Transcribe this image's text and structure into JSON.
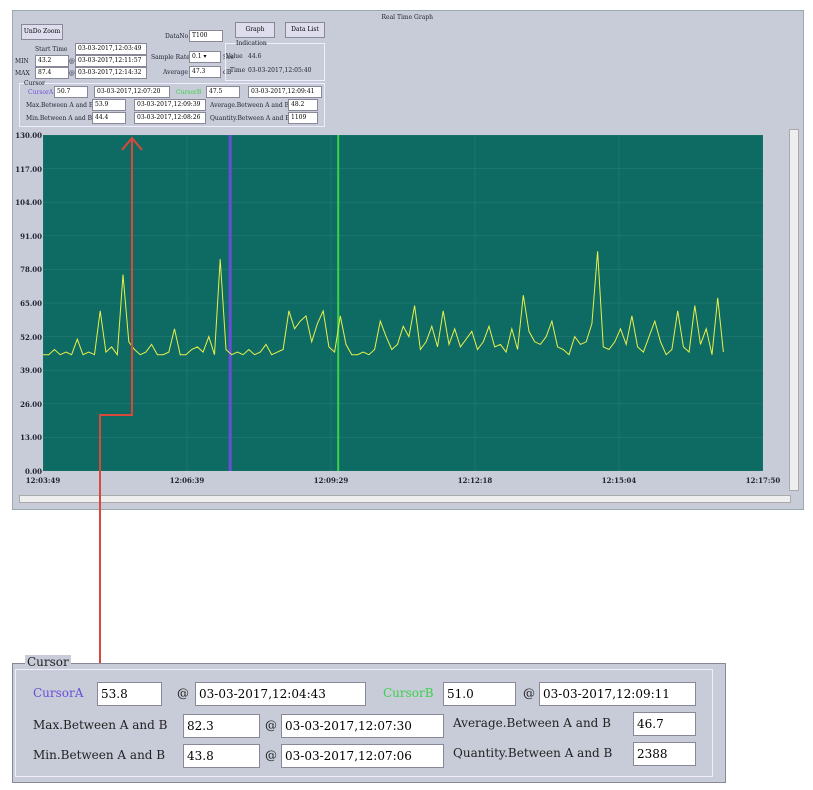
{
  "window": {
    "title": "Real Time Graph"
  },
  "toolbar": {
    "undo_zoom": "UnDo Zoom",
    "graph": "Graph",
    "data_list": "Data List"
  },
  "stats": {
    "data_no_label": "DataNo",
    "data_no": "T100",
    "start_time_label": "Start Time",
    "start_time": "03-03-2017,12:03:49",
    "min_label": "MIN",
    "min_value": "43.2",
    "min_time": "03-03-2017,12:11:57",
    "max_label": "MAX",
    "max_value": "87.4",
    "max_time": "03-03-2017,12:14:32",
    "at": "@",
    "sample_rate_label": "Sample Rate",
    "sample_rate": "0.1",
    "sample_rate_unit": "Sec",
    "average_label": "Average",
    "average": "47.3",
    "average_unit": "dB"
  },
  "indication": {
    "title": "Indication",
    "value_label": "Value",
    "value": "44.6",
    "time_label": "Time",
    "time": "03-03-2017,12:05:40"
  },
  "cursor_small": {
    "title": "Cursor",
    "a_label": "CursorA",
    "a_value": "50.7",
    "a_time": "03-03-2017,12:07:20",
    "b_label": "CursorB",
    "b_value": "47.5",
    "b_time": "03-03-2017,12:09:41",
    "max_label": "Max.Between A and B",
    "max_value": "53.9",
    "max_time": "03-03-2017,12:09:39",
    "min_label": "Min.Between A and B",
    "min_value": "44.4",
    "min_time": "03-03-2017,12:08:26",
    "avg_label": "Average.Between A and B",
    "avg_value": "48.2",
    "qty_label": "Quantity.Between A and B",
    "qty_value": "1109"
  },
  "cursor_zoomed": {
    "title": "Cursor",
    "a_label": "CursorA",
    "a_value": "53.8",
    "a_time": "03-03-2017,12:04:43",
    "b_label": "CursorB",
    "b_value": "51.0",
    "b_time": "03-03-2017,12:09:11",
    "max_label": "Max.Between A and B",
    "max_value": "82.3",
    "max_time": "03-03-2017,12:07:30",
    "min_label": "Min.Between A and B",
    "min_value": "43.8",
    "min_time": "03-03-2017,12:07:06",
    "avg_label": "Average.Between A and B",
    "avg_value": "46.7",
    "qty_label": "Quantity.Between A and B",
    "qty_value": "2388",
    "at": "@"
  },
  "colors": {
    "plot_bg": "#0e6b63",
    "line": "#e8f04a",
    "cursor_a": "#6a4cd8",
    "cursor_b": "#3ad24a",
    "arrow": "#d9483a"
  },
  "chart_data": {
    "type": "line",
    "ylim": [
      0,
      130
    ],
    "yticks": [
      "130.00",
      "117.00",
      "104.00",
      "91.00",
      "78.00",
      "65.00",
      "52.00",
      "39.00",
      "26.00",
      "13.00",
      "0.00"
    ],
    "xticks": [
      "12:03:49",
      "12:06:39",
      "12:09:29",
      "12:12:18",
      "12:15:04",
      "12:17:50"
    ],
    "cursor_a_frac": 0.26,
    "cursor_b_frac": 0.41,
    "values": [
      45,
      45,
      47,
      45,
      46,
      45,
      51,
      45,
      46,
      45,
      62,
      46,
      48,
      45,
      76,
      50,
      47,
      45,
      46,
      49,
      45,
      45,
      46,
      55,
      45,
      45,
      47,
      48,
      46,
      52,
      45,
      82,
      47,
      45,
      46,
      45,
      47,
      45,
      46,
      49,
      45,
      46,
      47,
      62,
      55,
      58,
      60,
      50,
      57,
      62,
      48,
      46,
      60,
      49,
      45,
      45,
      46,
      45,
      47,
      58,
      52,
      47,
      49,
      56,
      52,
      64,
      47,
      50,
      56,
      48,
      62,
      49,
      55,
      48,
      51,
      54,
      47,
      50,
      56,
      48,
      49,
      46,
      55,
      47,
      68,
      54,
      50,
      49,
      52,
      58,
      48,
      47,
      45,
      52,
      49,
      50,
      57,
      85,
      48,
      47,
      50,
      55,
      49,
      60,
      48,
      46,
      52,
      58,
      50,
      45,
      47,
      62,
      48,
      46,
      64,
      49,
      55,
      45,
      67,
      46
    ]
  }
}
